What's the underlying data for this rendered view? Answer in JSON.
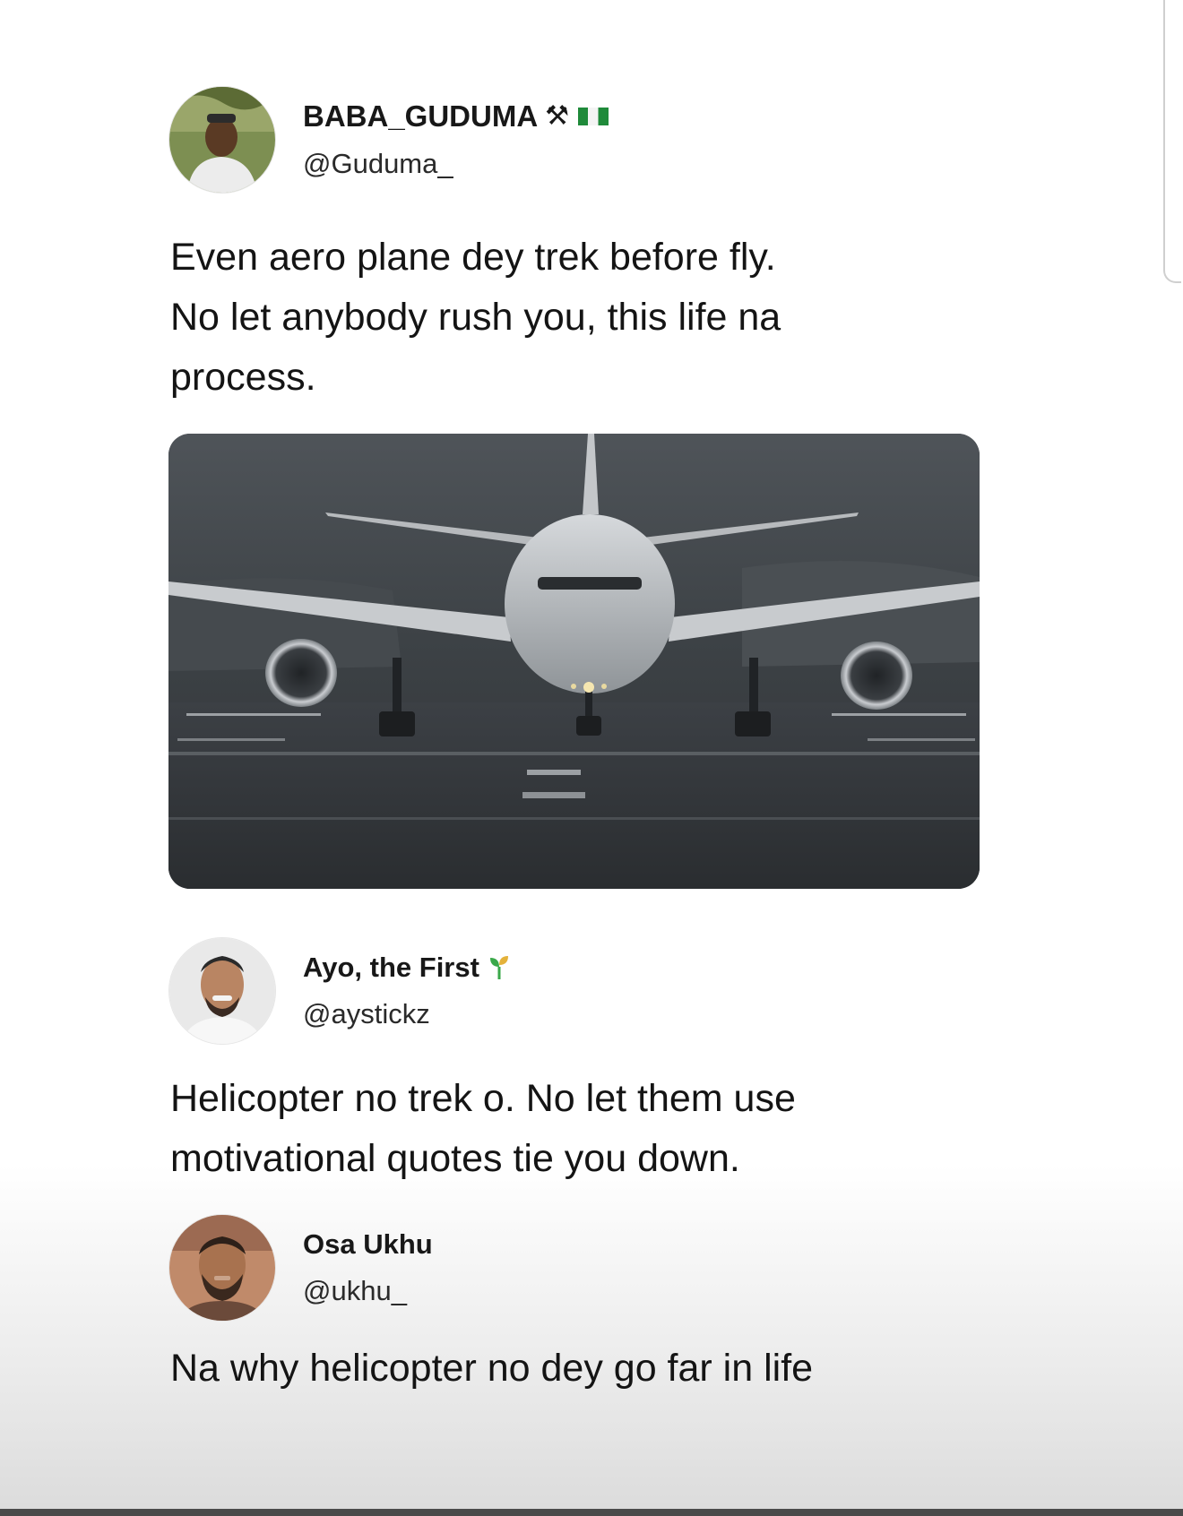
{
  "tweets": [
    {
      "display_name": "BABA_GUDUMA",
      "badge_symbol": "⚒",
      "handle": "@Guduma_",
      "text_lines": [
        "Even aero plane dey trek before fly.",
        "No let anybody rush you, this life na",
        "process."
      ],
      "media": "airplane-photo"
    },
    {
      "display_name": "Ayo, the First",
      "handle": "@aystickz",
      "text_lines": [
        "Helicopter no trek o. No let them use",
        "motivational quotes tie you down."
      ]
    },
    {
      "display_name": "Osa Ukhu",
      "handle": "@ukhu_",
      "text_lines": [
        "Na why helicopter no dey go far in life"
      ]
    }
  ],
  "colors": {
    "background": "#ffffff",
    "text": "#141414",
    "flag_green": "#1f8a3a",
    "sprout_green": "#3aa84a"
  },
  "icons": [
    "hammer-pick-icon",
    "nigeria-flag-icon",
    "sprout-icon"
  ]
}
